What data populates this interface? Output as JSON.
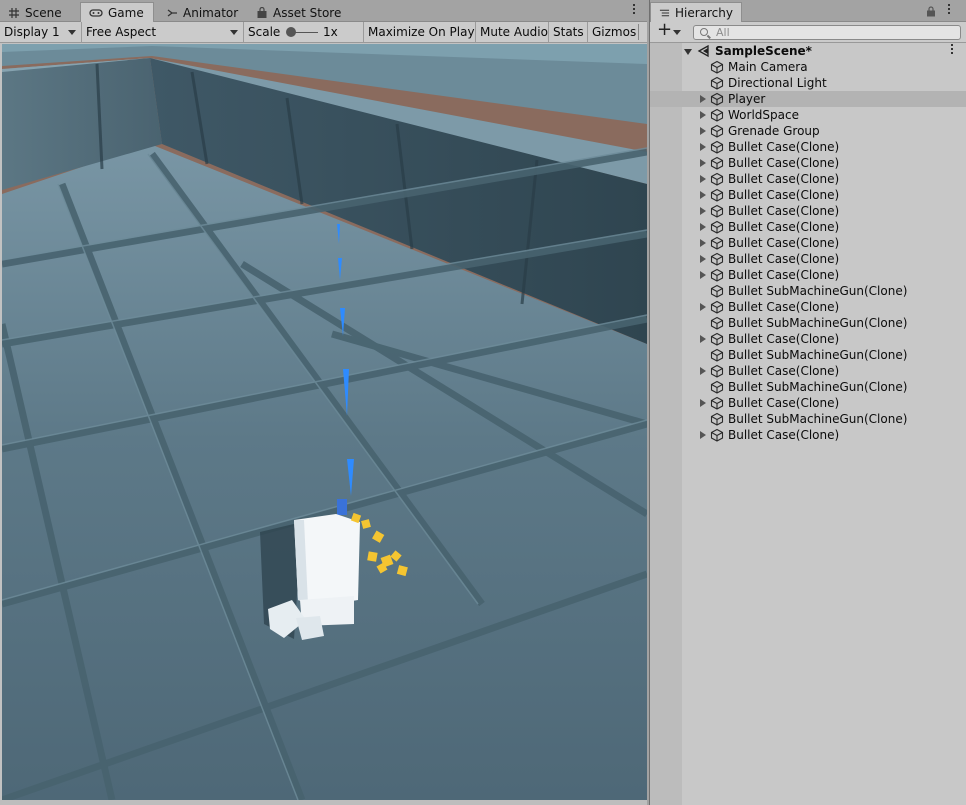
{
  "game": {
    "tabs": [
      {
        "label": "Scene",
        "icon": "grid-icon"
      },
      {
        "label": "Game",
        "icon": "gamepad-icon"
      },
      {
        "label": "Animator",
        "icon": "animator-icon"
      },
      {
        "label": "Asset Store",
        "icon": "bag-icon"
      }
    ],
    "toolbar": {
      "display": "Display 1",
      "aspect": "Free Aspect",
      "scale_label": "Scale",
      "scale_value": "1x",
      "maximize": "Maximize On Play",
      "mute": "Mute Audio",
      "stats": "Stats",
      "gizmos": "Gizmos"
    }
  },
  "hierarchy": {
    "tab_label": "Hierarchy",
    "add_label": "+",
    "search_placeholder": "All",
    "scene_name": "SampleScene*",
    "items": [
      {
        "label": "Main Camera",
        "foldout": false
      },
      {
        "label": "Directional Light",
        "foldout": false
      },
      {
        "label": "Player",
        "foldout": true
      },
      {
        "label": "WorldSpace",
        "foldout": true
      },
      {
        "label": "Grenade Group",
        "foldout": true
      },
      {
        "label": "Bullet Case(Clone)",
        "foldout": true
      },
      {
        "label": "Bullet Case(Clone)",
        "foldout": true
      },
      {
        "label": "Bullet Case(Clone)",
        "foldout": true
      },
      {
        "label": "Bullet Case(Clone)",
        "foldout": true
      },
      {
        "label": "Bullet Case(Clone)",
        "foldout": true
      },
      {
        "label": "Bullet Case(Clone)",
        "foldout": true
      },
      {
        "label": "Bullet Case(Clone)",
        "foldout": true
      },
      {
        "label": "Bullet Case(Clone)",
        "foldout": true
      },
      {
        "label": "Bullet Case(Clone)",
        "foldout": true
      },
      {
        "label": "Bullet SubMachineGun(Clone)",
        "foldout": false
      },
      {
        "label": "Bullet Case(Clone)",
        "foldout": true
      },
      {
        "label": "Bullet SubMachineGun(Clone)",
        "foldout": false
      },
      {
        "label": "Bullet Case(Clone)",
        "foldout": true
      },
      {
        "label": "Bullet SubMachineGun(Clone)",
        "foldout": false
      },
      {
        "label": "Bullet Case(Clone)",
        "foldout": true
      },
      {
        "label": "Bullet SubMachineGun(Clone)",
        "foldout": false
      },
      {
        "label": "Bullet Case(Clone)",
        "foldout": true
      },
      {
        "label": "Bullet SubMachineGun(Clone)",
        "foldout": false
      },
      {
        "label": "Bullet Case(Clone)",
        "foldout": true
      }
    ],
    "hover_index": 2
  },
  "colors": {
    "floor": "#587381",
    "wall": "#3e5865",
    "bullet": "#2e8bff",
    "casing": "#f5c531",
    "player": "#f4f7f9"
  }
}
